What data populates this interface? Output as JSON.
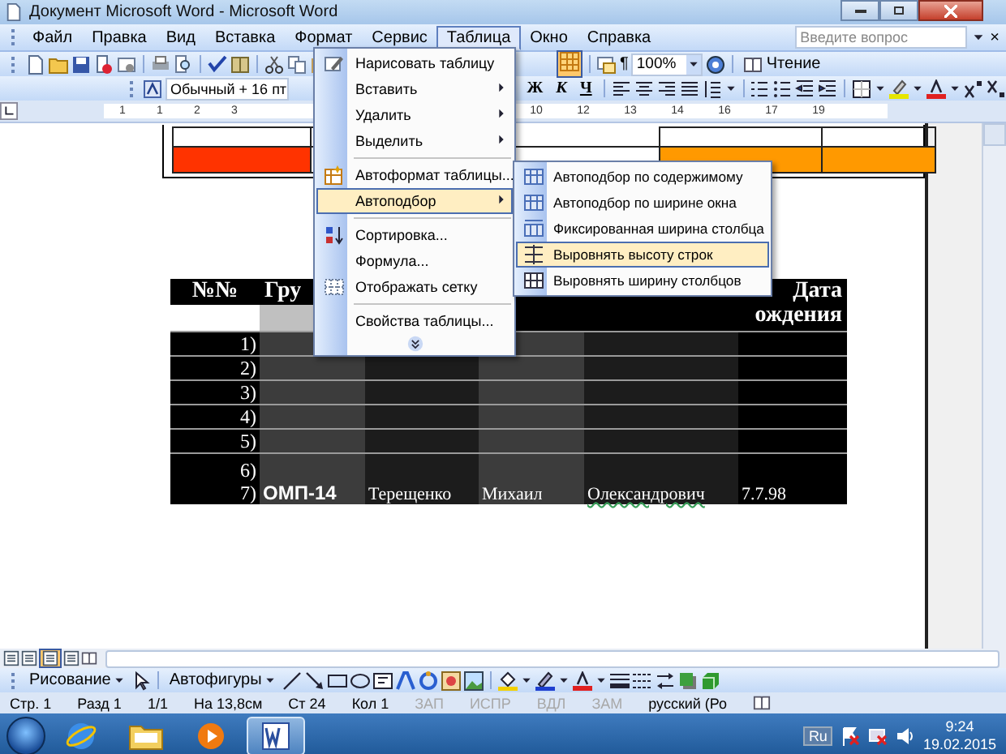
{
  "window": {
    "title": "Документ Microsoft Word - Microsoft Word"
  },
  "menu_bar": {
    "items": [
      {
        "label": "Файл",
        "selected": false
      },
      {
        "label": "Правка",
        "selected": false
      },
      {
        "label": "Вид",
        "selected": false
      },
      {
        "label": "Вставка",
        "selected": false
      },
      {
        "label": "Формат",
        "selected": false
      },
      {
        "label": "Сервис",
        "selected": false
      },
      {
        "label": "Таблица",
        "selected": true
      },
      {
        "label": "Окно",
        "selected": false
      },
      {
        "label": "Справка",
        "selected": false
      }
    ],
    "help_search": {
      "placeholder": "Введите вопрос"
    },
    "close_document": "×"
  },
  "standard_toolbar": {
    "pilcrow": "¶",
    "zoom": "100%",
    "reading_button": "Чтение"
  },
  "formatting_toolbar": {
    "style": "Обычный + 16 пт",
    "bold": "Ж",
    "italic": "К",
    "underline": "Ч"
  },
  "ruler": {
    "left_labels": [
      "1",
      "1",
      "2",
      "3"
    ],
    "right_labels": [
      "10",
      "12",
      "13",
      "14",
      "16",
      "17",
      "19"
    ]
  },
  "table": {
    "header": {
      "number": "№№",
      "group": "Гру",
      "birth_date": [
        "Дата",
        "ождения"
      ]
    },
    "rows": [
      {
        "number": [
          "1)"
        ]
      },
      {
        "number": [
          "2)"
        ]
      },
      {
        "number": [
          "3)"
        ]
      },
      {
        "number": [
          "4)"
        ]
      },
      {
        "number": [
          "5)"
        ]
      },
      {
        "number": [
          "6)",
          "7)"
        ],
        "cells": [
          {
            "text": "ОМП-14",
            "kind": "group"
          },
          {
            "text": "Терещенко",
            "kind": "plain"
          },
          {
            "text": "Михаил",
            "kind": "plain"
          },
          {
            "text": "Олександрович",
            "kind": "flagged"
          },
          {
            "text": "7.7.98",
            "kind": "plain"
          }
        ]
      }
    ]
  },
  "table_menu": {
    "items": [
      {
        "label": "Нарисовать таблицу",
        "kind": "command",
        "selected": false
      },
      {
        "label": "Вставить",
        "kind": "submenu",
        "selected": false
      },
      {
        "label": "Удалить",
        "kind": "submenu",
        "selected": false
      },
      {
        "label": "Выделить",
        "kind": "submenu",
        "selected": false
      },
      {
        "kind": "separator"
      },
      {
        "label": "Автоформат таблицы...",
        "kind": "command",
        "selected": false
      },
      {
        "label": "Автоподбор",
        "kind": "submenu",
        "selected": true
      },
      {
        "kind": "separator"
      },
      {
        "label": "Сортировка...",
        "kind": "command",
        "selected": false
      },
      {
        "label": "Формула...",
        "kind": "command",
        "selected": false
      },
      {
        "label": "Отображать сетку",
        "kind": "command",
        "selected": false
      },
      {
        "kind": "separator"
      },
      {
        "label": "Свойства таблицы...",
        "kind": "command",
        "selected": false
      },
      {
        "kind": "expand"
      }
    ]
  },
  "autofit_submenu": {
    "items": [
      {
        "label": "Автоподбор по содержимому",
        "selected": false
      },
      {
        "label": "Автоподбор по ширине окна",
        "selected": false
      },
      {
        "label": "Фиксированная ширина столбца",
        "selected": false
      },
      {
        "label": "Выровнять высоту строк",
        "selected": true
      },
      {
        "label": "Выровнять ширину столбцов",
        "selected": false
      }
    ]
  },
  "drawing_toolbar": {
    "drawing_menu": "Рисование",
    "autoshapes_menu": "Автофигуры"
  },
  "status_bar": {
    "items": [
      {
        "text": "Стр. 1",
        "disabled": false
      },
      {
        "text": "Разд 1",
        "disabled": false
      },
      {
        "text": "1/1",
        "disabled": false
      },
      {
        "text": "На 13,8см",
        "disabled": false
      },
      {
        "text": "Ст 24",
        "disabled": false
      },
      {
        "text": "Кол 1",
        "disabled": false
      },
      {
        "text": "ЗАП",
        "disabled": true
      },
      {
        "text": "ИСПР",
        "disabled": true
      },
      {
        "text": "ВДЛ",
        "disabled": true
      },
      {
        "text": "ЗАМ",
        "disabled": true
      },
      {
        "text": "русский (Ро",
        "disabled": false
      }
    ]
  },
  "taskbar": {
    "apps": [
      {
        "kind": "browser",
        "selected": false
      },
      {
        "kind": "folder",
        "selected": false
      },
      {
        "kind": "media",
        "selected": false
      },
      {
        "kind": "word",
        "selected": true
      }
    ],
    "language": "Ru",
    "time": "9:24",
    "date": "19.02.2015"
  }
}
